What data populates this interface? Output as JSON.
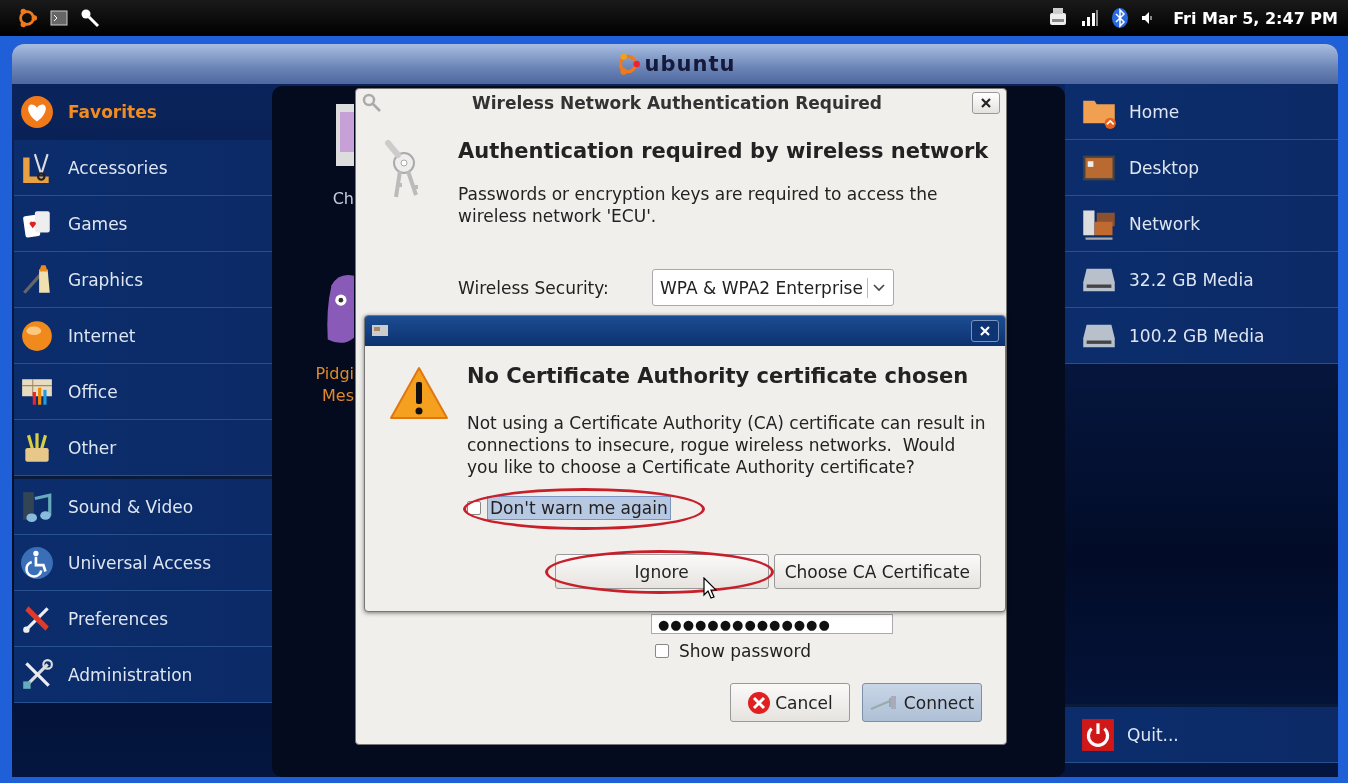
{
  "top_panel": {
    "clock": "Fri Mar 5, 2:47 PM"
  },
  "header": {
    "logo_text": "ubuntu"
  },
  "category_groups": [
    {
      "items": [
        {
          "label": "Favorites",
          "kind": "favorites",
          "selected": true
        },
        {
          "label": "Accessories",
          "kind": "accessories",
          "selected": false
        },
        {
          "label": "Games",
          "kind": "games",
          "selected": false
        },
        {
          "label": "Graphics",
          "kind": "graphics",
          "selected": false
        },
        {
          "label": "Internet",
          "kind": "internet",
          "selected": false
        },
        {
          "label": "Office",
          "kind": "office",
          "selected": false
        },
        {
          "label": "Other",
          "kind": "other",
          "selected": false
        }
      ]
    },
    {
      "items": [
        {
          "label": "Sound & Video",
          "kind": "sound",
          "selected": false
        },
        {
          "label": "Universal Access",
          "kind": "access",
          "selected": false
        },
        {
          "label": "Preferences",
          "kind": "preferences",
          "selected": false
        },
        {
          "label": "Administration",
          "kind": "administration",
          "selected": false
        }
      ]
    }
  ],
  "apps": [
    {
      "lines": [
        "Ch"
      ],
      "kind": "chat",
      "selected": false
    },
    {
      "lines": [
        "Pidgi",
        "Mes"
      ],
      "kind": "pidgin",
      "selected": true
    }
  ],
  "places": [
    {
      "label": "Home",
      "kind": "home"
    },
    {
      "label": "Desktop",
      "kind": "desktop"
    },
    {
      "label": "Network",
      "kind": "network"
    },
    {
      "label": "32.2 GB Media",
      "kind": "drive"
    },
    {
      "label": "100.2 GB Media",
      "kind": "drive"
    }
  ],
  "quit": {
    "label": "Quit...",
    "kind": "quit"
  },
  "auth_dialog": {
    "title": "Wireless Network Authentication Required",
    "heading": "Authentication required by wireless network",
    "description": "Passwords or encryption keys are required to access the wireless network 'ECU'.",
    "security_label": "Wireless Security:",
    "security_value": "WPA & WPA2 Enterprise",
    "password_value": "●●●●●●●●●●●●●●",
    "show_password": {
      "label": "Show password",
      "checked": false
    },
    "buttons": [
      {
        "label": "Cancel",
        "kind": "cancel",
        "default": false
      },
      {
        "label": "Connect",
        "kind": "connect",
        "default": true
      }
    ]
  },
  "ca_dialog": {
    "heading": "No Certificate Authority certificate chosen",
    "message": "Not using a Certificate Authority (CA) certificate can result in\nconnections to insecure, rogue wireless networks.  Would\nyou like to choose a Certificate Authority certificate?",
    "dont_warn": {
      "label": "Don't warn me again",
      "checked": false,
      "focused": true,
      "circled": true
    },
    "buttons": [
      {
        "label": "Ignore",
        "kind": "ignore",
        "circled": true
      },
      {
        "label": "Choose CA Certificate",
        "kind": "choose",
        "circled": false
      }
    ]
  }
}
